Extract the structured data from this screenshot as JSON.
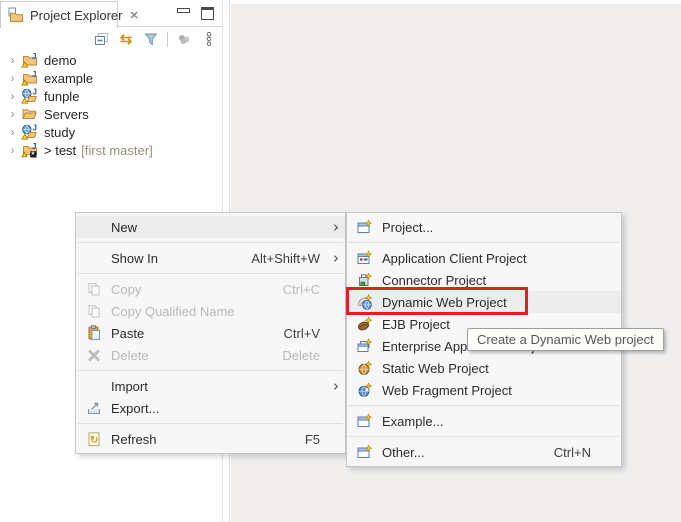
{
  "colors": {
    "annotation_red": "#e41d1d",
    "menu_bg": "#f7f7f7",
    "menu_highlight": "#ececec",
    "editor_bg": "#f0efee",
    "disabled_text": "#b9b9b9",
    "git_decoration_text": "#95907a",
    "gold_icon": "#d09020"
  },
  "glyphs": {
    "chevron_right": "›",
    "submenu_arrow": "›",
    "close": "✕",
    "link_arrows": "⇆"
  },
  "panel": {
    "tab_title": "Project Explorer",
    "toolbar_icons": [
      "collapse-all",
      "link-with-editor",
      "filter",
      "view-menu",
      "overflow-menu"
    ],
    "tree": [
      {
        "label": "demo",
        "icon": "java-project-warning-icon"
      },
      {
        "label": "example",
        "icon": "java-project-warning-icon"
      },
      {
        "label": "funple",
        "icon": "web-project-warning-icon"
      },
      {
        "label": "Servers",
        "icon": "folder-icon"
      },
      {
        "label": "study",
        "icon": "web-project-warning-icon"
      },
      {
        "label": "> test",
        "decoration": "[first master]",
        "icon": "java-project-git-icon"
      }
    ]
  },
  "context_menu": {
    "items": [
      {
        "label": "New",
        "submenu": true,
        "highlighted": true
      },
      {
        "label": "Show In",
        "accel": "Alt+Shift+W",
        "submenu": true
      },
      {
        "label": "Copy",
        "accel": "Ctrl+C",
        "disabled": true,
        "icon": "copy-icon"
      },
      {
        "label": "Copy Qualified Name",
        "disabled": true,
        "icon": "copy-icon"
      },
      {
        "label": "Paste",
        "accel": "Ctrl+V",
        "icon": "paste-icon"
      },
      {
        "label": "Delete",
        "accel": "Delete",
        "disabled": true,
        "icon": "delete-icon"
      },
      {
        "label": "Import",
        "submenu": true
      },
      {
        "label": "Export...",
        "icon": "export-icon"
      },
      {
        "label": "Refresh",
        "accel": "F5",
        "icon": "refresh-icon"
      }
    ]
  },
  "new_submenu": {
    "items": [
      {
        "label": "Project...",
        "icon": "new-project-icon"
      },
      {
        "label": "Application Client Project",
        "icon": "app-client-project-icon"
      },
      {
        "label": "Connector Project",
        "icon": "connector-project-icon"
      },
      {
        "label": "Dynamic Web Project",
        "icon": "dynamic-web-project-icon",
        "highlighted": true
      },
      {
        "label": "EJB Project",
        "icon": "ejb-project-icon"
      },
      {
        "label": "Enterprise Application Project",
        "icon": "enterprise-app-project-icon"
      },
      {
        "label": "Static Web Project",
        "icon": "static-web-project-icon"
      },
      {
        "label": "Web Fragment Project",
        "icon": "web-fragment-project-icon"
      },
      {
        "label": "Example...",
        "icon": "new-wizard-icon"
      },
      {
        "label": "Other...",
        "accel": "Ctrl+N",
        "icon": "new-wizard-icon"
      }
    ]
  },
  "annotations": {
    "tooltip_text": "Create a Dynamic Web project"
  }
}
